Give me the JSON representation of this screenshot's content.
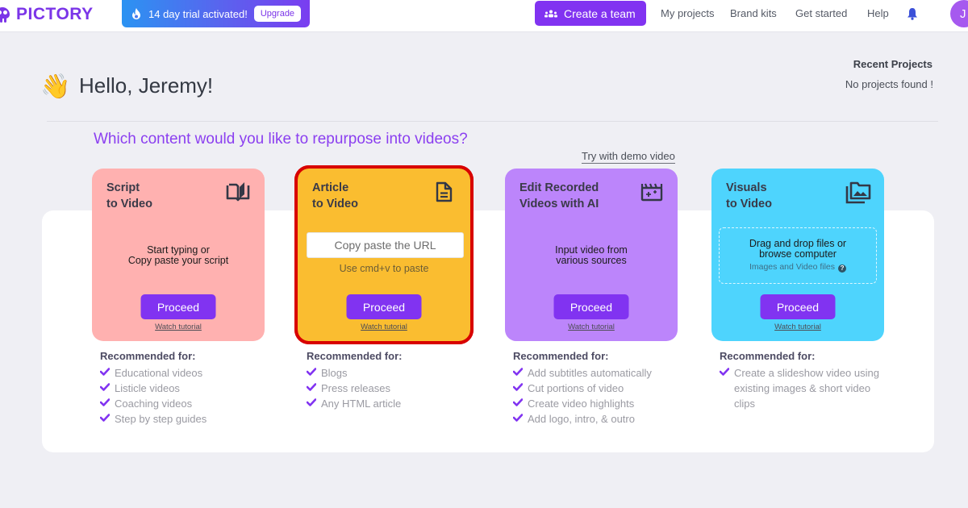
{
  "brand": {
    "name": "PICTORY",
    "accent": "#7b35e8"
  },
  "trial": {
    "text": "14 day trial activated!",
    "upgrade_label": "Upgrade"
  },
  "nav": {
    "create_team_label": "Create a team",
    "links": [
      "My projects",
      "Brand kits",
      "Get started",
      "Help"
    ],
    "avatar_initial": "J"
  },
  "greeting": {
    "emoji": "👋",
    "text": "Hello, Jeremy!"
  },
  "recent_projects": {
    "title": "Recent Projects",
    "empty_text": "No projects found !"
  },
  "question": "Which content would you like to repurpose into videos?",
  "demo_link": "Try with demo video",
  "cards": [
    {
      "title": "Script\nto Video",
      "icon": "book-open-icon",
      "color": "#ffb1b0",
      "description": "Start typing or\nCopy paste your script",
      "proceed_label": "Proceed",
      "tutorial_label": "Watch tutorial"
    },
    {
      "title": "Article\nto Video",
      "icon": "document-icon",
      "color": "#fabd30",
      "url_placeholder": "Copy paste the URL",
      "url_value": "",
      "hint": "Use cmd+v to paste",
      "proceed_label": "Proceed",
      "tutorial_label": "Watch tutorial",
      "highlighted": true,
      "highlight_color": "#d80000"
    },
    {
      "title": "Edit Recorded\nVideos with AI",
      "icon": "clapperboard-icon",
      "color": "#bc85fb",
      "description": "Input video from\nvarious sources",
      "proceed_label": "Proceed",
      "tutorial_label": "Watch tutorial"
    },
    {
      "title": "Visuals\nto Video",
      "icon": "image-folder-icon",
      "color": "#4ed4fd",
      "dropzone_text": "Drag and drop files or\nbrowse computer",
      "dropzone_sub": "Images and Video files",
      "proceed_label": "Proceed",
      "tutorial_label": "Watch tutorial"
    }
  ],
  "recommendations": [
    {
      "title": "Recommended for:",
      "items": [
        "Educational videos",
        "Listicle videos",
        "Coaching videos",
        "Step by step guides"
      ]
    },
    {
      "title": "Recommended for:",
      "items": [
        "Blogs",
        "Press releases",
        "Any HTML article"
      ]
    },
    {
      "title": "Recommended for:",
      "items": [
        "Add subtitles automatically",
        "Cut portions of video",
        "Create video highlights",
        "Add logo, intro, & outro"
      ]
    },
    {
      "title": "Recommended for:",
      "items": [
        "Create a slideshow video using existing images & short video clips"
      ]
    }
  ]
}
